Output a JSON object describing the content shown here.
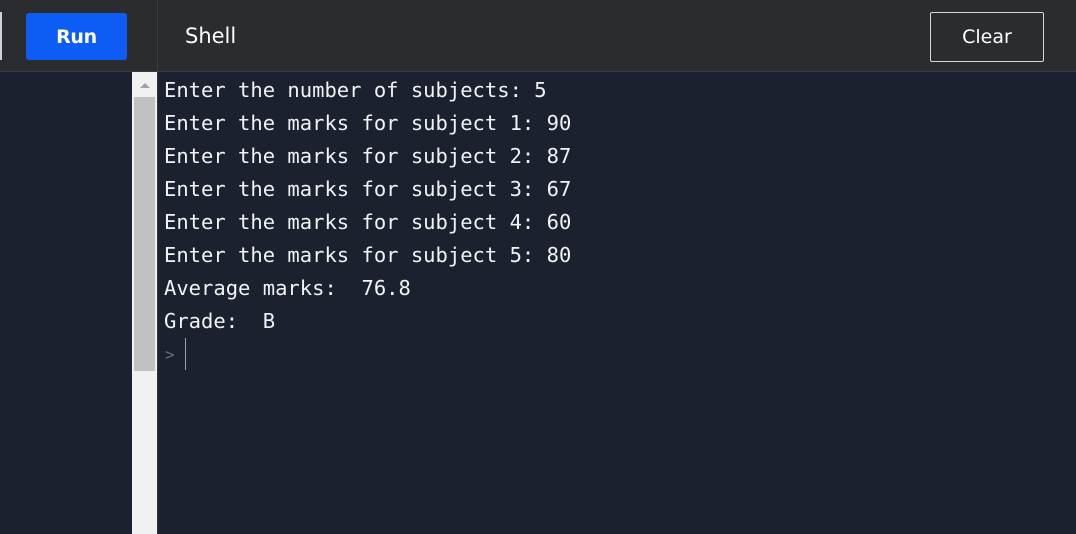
{
  "toolbar": {
    "run_label": "Run",
    "shell_title": "Shell",
    "clear_label": "Clear"
  },
  "console": {
    "lines": [
      "Enter the number of subjects: 5",
      "Enter the marks for subject 1: 90",
      "Enter the marks for subject 2: 87",
      "Enter the marks for subject 3: 67",
      "Enter the marks for subject 4: 60",
      "Enter the marks for subject 5: 80",
      "Average marks:  76.8",
      "Grade:  B"
    ],
    "prompt": ">"
  },
  "icons": {
    "scroll_up": "chevron-up-icon"
  },
  "colors": {
    "run_button": "#0d5cf5",
    "console_background": "#1c2130",
    "toolbar_background": "#2b2c30"
  }
}
